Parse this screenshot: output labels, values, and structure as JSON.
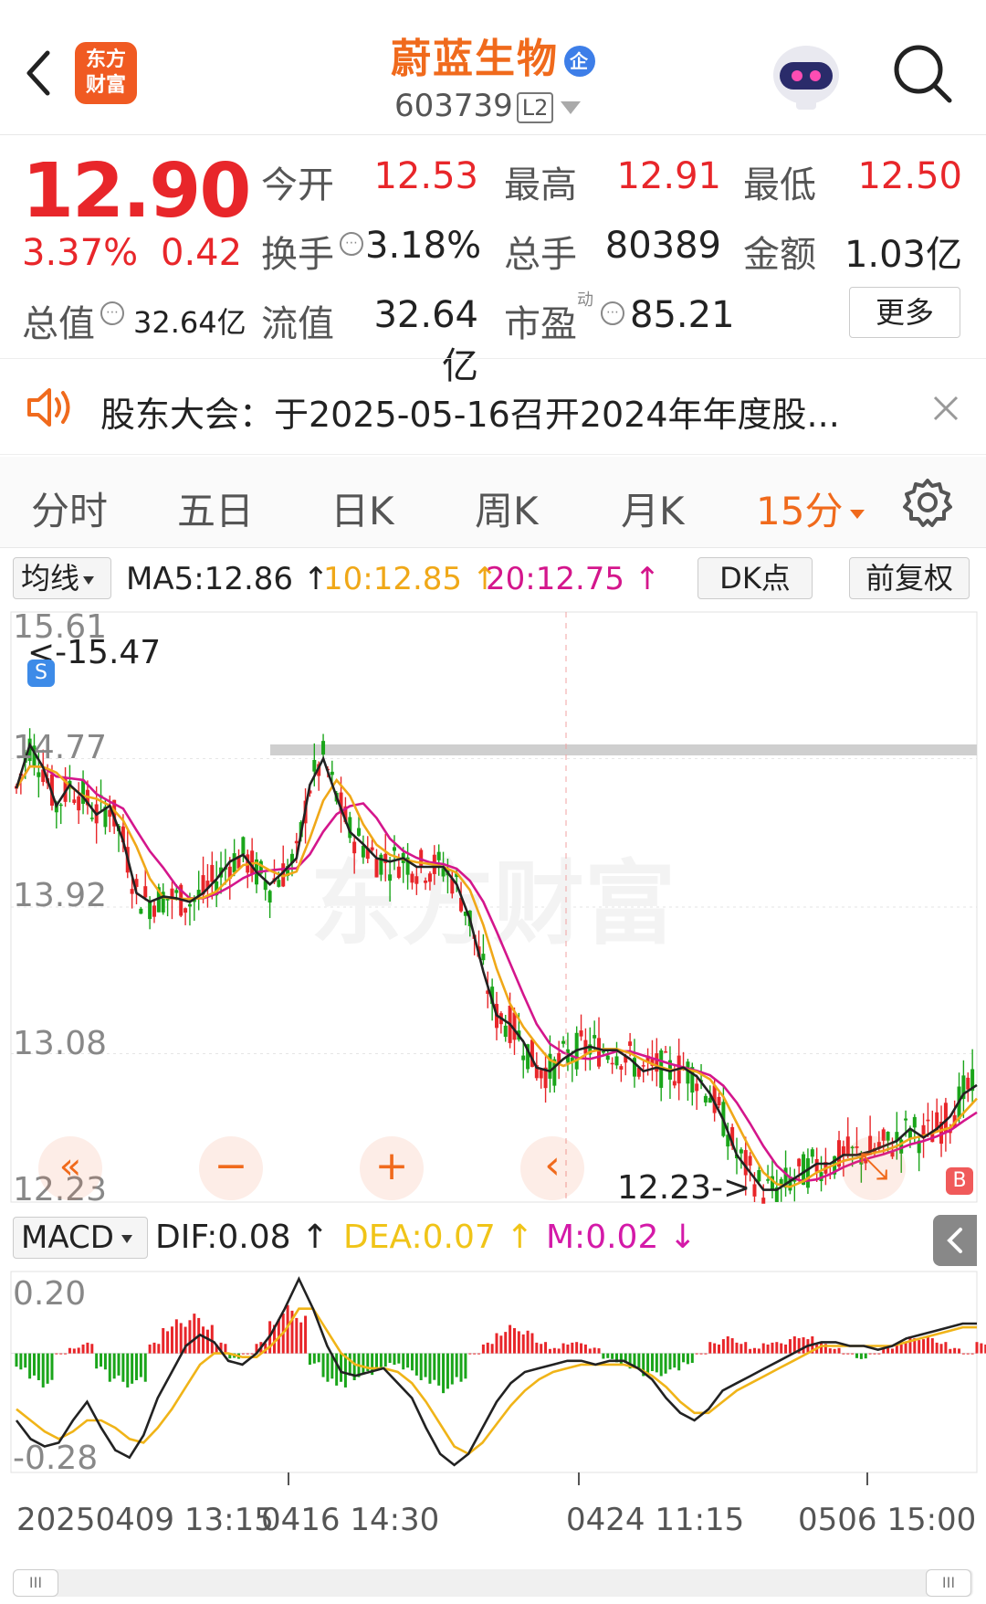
{
  "header": {
    "stock_name": "蔚蓝生物",
    "enterprise_badge": "企",
    "stock_code": "603739",
    "level": "L2",
    "logo_text_top": "东方",
    "logo_text_bottom": "财富"
  },
  "quote": {
    "price": "12.90",
    "change_pct": "3.37%",
    "change": "0.42",
    "open_label": "今开",
    "open": "12.53",
    "high_label": "最高",
    "high": "12.91",
    "low_label": "最低",
    "low": "12.50",
    "turnover_label": "换手",
    "turnover": "3.18%",
    "volume_label": "总手",
    "volume": "80389",
    "amount_label": "金额",
    "amount": "1.03亿",
    "mktcap_label": "总值",
    "mktcap": "32.64亿",
    "float_label": "流值",
    "float_cap": "32.64亿",
    "pe_label": "市盈",
    "pe_sup": "动",
    "pe": "85.21",
    "more_label": "更多"
  },
  "notice": {
    "text": "股东大会：于2025-05-16召开2024年年度股..."
  },
  "tabs": [
    "分时",
    "五日",
    "日K",
    "周K",
    "月K",
    "15分"
  ],
  "active_tab": "15分",
  "ma_bar": {
    "selector": "均线",
    "ma5": "MA5:12.86 ↑",
    "ma10": "10:12.85 ↑",
    "ma20": "20:12.75 ↑",
    "dk_label": "DK点",
    "adjust_label": "前复权"
  },
  "colors": {
    "up": "#e8262a",
    "down": "#1aa51a",
    "ma5": "#222222",
    "ma10": "#f0a818",
    "ma20": "#d4168c",
    "accent": "#f06a1c"
  },
  "chart_data": {
    "type": "candlestick",
    "y_ticks": [
      "15.61",
      "14.77",
      "13.92",
      "13.08",
      "12.23"
    ],
    "ylim": [
      12.23,
      15.61
    ],
    "annotations": {
      "high_marker": "<-15.47",
      "low_marker": "12.23->",
      "s_badge": "S",
      "b_badge": "B"
    },
    "resistance_level": 14.82,
    "ma5_close": [
      14.6,
      14.85,
      14.72,
      14.5,
      14.62,
      14.55,
      14.45,
      14.5,
      14.3,
      14.0,
      13.95,
      13.98,
      13.97,
      13.95,
      14.0,
      14.08,
      14.18,
      14.22,
      14.12,
      14.05,
      14.12,
      14.2,
      14.62,
      14.77,
      14.55,
      14.35,
      14.28,
      14.2,
      14.18,
      14.2,
      14.15,
      14.15,
      14.15,
      14.05,
      13.85,
      13.55,
      13.3,
      13.25,
      13.15,
      13.0,
      12.98,
      13.05,
      13.1,
      13.12,
      13.1,
      13.1,
      13.05,
      12.98,
      13.0,
      12.98,
      13.0,
      12.95,
      12.85,
      12.7,
      12.5,
      12.4,
      12.3,
      12.3,
      12.35,
      12.4,
      12.45,
      12.45,
      12.5,
      12.5,
      12.52,
      12.55,
      12.58,
      12.65,
      12.6,
      12.65,
      12.72,
      12.85,
      12.9
    ],
    "ma10": "rolling 10 of ma5_close",
    "ma20": "rolling 20 of ma5_close"
  },
  "controls": [
    "«",
    "−",
    "+",
    "‹",
    "⤡"
  ],
  "macd": {
    "selector": "MACD",
    "dif": "DIF:0.08 ↑",
    "dea": "DEA:0.07 ↑",
    "m": "M:0.02 ↓",
    "y_ticks": [
      "0.20",
      "-0.28"
    ],
    "hist": [
      -0.03,
      -0.05,
      -0.06,
      0.0,
      0.01,
      0.02,
      -0.03,
      -0.05,
      -0.06,
      -0.05,
      0.02,
      0.05,
      0.06,
      0.07,
      0.05,
      0.02,
      -0.01,
      0.0,
      0.02,
      0.06,
      0.09,
      0.07,
      -0.02,
      -0.05,
      -0.06,
      -0.05,
      -0.04,
      -0.03,
      -0.02,
      -0.03,
      -0.05,
      -0.06,
      -0.07,
      -0.05,
      0.0,
      0.02,
      0.04,
      0.05,
      0.04,
      0.02,
      0.01,
      0.02,
      0.02,
      0.01,
      -0.01,
      -0.02,
      -0.03,
      -0.04,
      -0.04,
      -0.03,
      -0.02,
      0.0,
      0.02,
      0.03,
      0.02,
      0.01,
      0.02,
      0.02,
      0.03,
      0.03,
      0.02,
      0.01,
      0.0,
      -0.01,
      0.0,
      0.01,
      0.02,
      0.03,
      0.03,
      0.02,
      0.01,
      0.0,
      0.02
    ],
    "dif_line": [
      -0.18,
      -0.23,
      -0.25,
      -0.24,
      -0.18,
      -0.13,
      -0.2,
      -0.26,
      -0.28,
      -0.22,
      -0.12,
      -0.05,
      0.02,
      0.05,
      0.03,
      -0.02,
      -0.03,
      0.0,
      0.05,
      0.12,
      0.2,
      0.12,
      0.02,
      -0.05,
      -0.06,
      -0.05,
      -0.04,
      -0.08,
      -0.12,
      -0.2,
      -0.27,
      -0.3,
      -0.27,
      -0.2,
      -0.13,
      -0.08,
      -0.05,
      -0.04,
      -0.03,
      -0.02,
      -0.02,
      -0.03,
      -0.02,
      -0.02,
      -0.04,
      -0.07,
      -0.12,
      -0.16,
      -0.18,
      -0.15,
      -0.1,
      -0.08,
      -0.06,
      -0.04,
      -0.02,
      0.0,
      0.02,
      0.03,
      0.03,
      0.02,
      0.02,
      0.01,
      0.02,
      0.04,
      0.05,
      0.06,
      0.07,
      0.08,
      0.08
    ],
    "dea_line": [
      -0.15,
      -0.18,
      -0.21,
      -0.23,
      -0.21,
      -0.18,
      -0.18,
      -0.2,
      -0.23,
      -0.24,
      -0.2,
      -0.15,
      -0.09,
      -0.03,
      0.0,
      0.0,
      -0.01,
      -0.01,
      0.02,
      0.06,
      0.12,
      0.12,
      0.06,
      0.0,
      -0.03,
      -0.04,
      -0.04,
      -0.05,
      -0.08,
      -0.13,
      -0.19,
      -0.25,
      -0.27,
      -0.24,
      -0.19,
      -0.14,
      -0.1,
      -0.07,
      -0.05,
      -0.04,
      -0.03,
      -0.03,
      -0.03,
      -0.03,
      -0.04,
      -0.06,
      -0.09,
      -0.13,
      -0.16,
      -0.16,
      -0.13,
      -0.1,
      -0.08,
      -0.06,
      -0.04,
      -0.02,
      0.0,
      0.02,
      0.02,
      0.02,
      0.02,
      0.02,
      0.02,
      0.03,
      0.04,
      0.05,
      0.06,
      0.07,
      0.07
    ]
  },
  "x_axis": [
    "20250409 13:15",
    "0416 14:30",
    "0424 11:15",
    "0506 15:00"
  ],
  "scrollbar": {
    "handle_glyph": "III"
  }
}
